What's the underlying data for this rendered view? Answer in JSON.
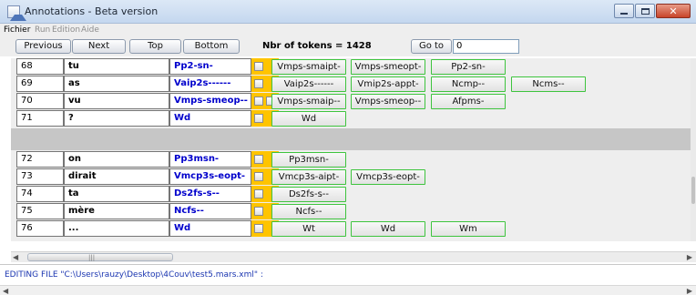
{
  "window": {
    "title": "Annotations - Beta version"
  },
  "menu": {
    "items": [
      "Fichier",
      "Run",
      "Edition",
      "Aide"
    ]
  },
  "toolbar": {
    "previous": "Previous",
    "next": "Next",
    "top": "Top",
    "bottom": "Bottom",
    "tokens_label": "Nbr of tokens = 1428",
    "goto": "Go to",
    "goto_value": "0"
  },
  "rows": [
    {
      "num": "68",
      "word": "tu",
      "tag": "Pp2-sn-",
      "checks": 1,
      "choices": [
        "Vmps-smaipt-",
        "Vmps-smeopt-",
        "Pp2-sn-"
      ]
    },
    {
      "num": "69",
      "word": "as",
      "tag": "Vaip2s------",
      "checks": 1,
      "choices": [
        "Vaip2s------",
        "Vmip2s-appt-",
        "Ncmp--",
        "Ncms--"
      ]
    },
    {
      "num": "70",
      "word": "vu",
      "tag": "Vmps-smeop--",
      "checks": 2,
      "choices": [
        "Vmps-smaip--",
        "Vmps-smeop--",
        "Afpms-"
      ]
    },
    {
      "num": "71",
      "word": "?",
      "tag": "Wd",
      "checks": 1,
      "choices": [
        "Wd"
      ]
    },
    {
      "num": "72",
      "word": "on",
      "tag": "Pp3msn-",
      "checks": 1,
      "choices": [
        "Pp3msn-"
      ]
    },
    {
      "num": "73",
      "word": "dirait",
      "tag": "Vmcp3s-eopt-",
      "checks": 1,
      "choices": [
        "Vmcp3s-aipt-",
        "Vmcp3s-eopt-"
      ]
    },
    {
      "num": "74",
      "word": "ta",
      "tag": "Ds2fs-s--",
      "checks": 1,
      "choices": [
        "Ds2fs-s--"
      ]
    },
    {
      "num": "75",
      "word": "mère",
      "tag": "Ncfs--",
      "checks": 1,
      "choices": [
        "Ncfs--"
      ]
    },
    {
      "num": "76",
      "word": "...",
      "tag": "Wd",
      "checks": 1,
      "choices": [
        "Wt",
        "Wd",
        "Wm"
      ]
    }
  ],
  "status": {
    "text": "EDITING FILE \"C:\\Users\\rauzy\\Desktop\\4Couv\\test5.mars.xml\" :"
  },
  "colors": {
    "tag_text": "#0000cc",
    "flag_cell": "#ffc400",
    "choice_border": "#3ec43e",
    "separator": "#c6c6c6",
    "status_text": "#1a35b0"
  }
}
